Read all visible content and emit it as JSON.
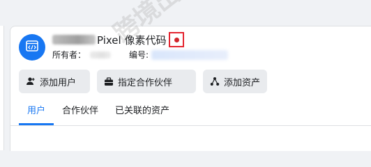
{
  "header": {
    "title": "Pixel 像素代码",
    "owner_label": "所有者：",
    "id_label": "编号:"
  },
  "buttons": {
    "add_user": "添加用户",
    "assign_partner": "指定合作伙伴",
    "add_asset": "添加资产"
  },
  "tabs": [
    {
      "label": "用户",
      "active": true
    },
    {
      "label": "合作伙伴",
      "active": false
    },
    {
      "label": "已关联的资产",
      "active": false
    }
  ],
  "watermark": "跨境出海陆路",
  "colors": {
    "accent": "#1877f2",
    "status": "#d0252c",
    "highlight_box": "#e4242f"
  },
  "icons": {
    "avatar": "code-icon",
    "add_user": "add-person-icon",
    "assign_partner": "briefcase-icon",
    "add_asset": "asset-icon",
    "status": "status-dot-icon"
  }
}
